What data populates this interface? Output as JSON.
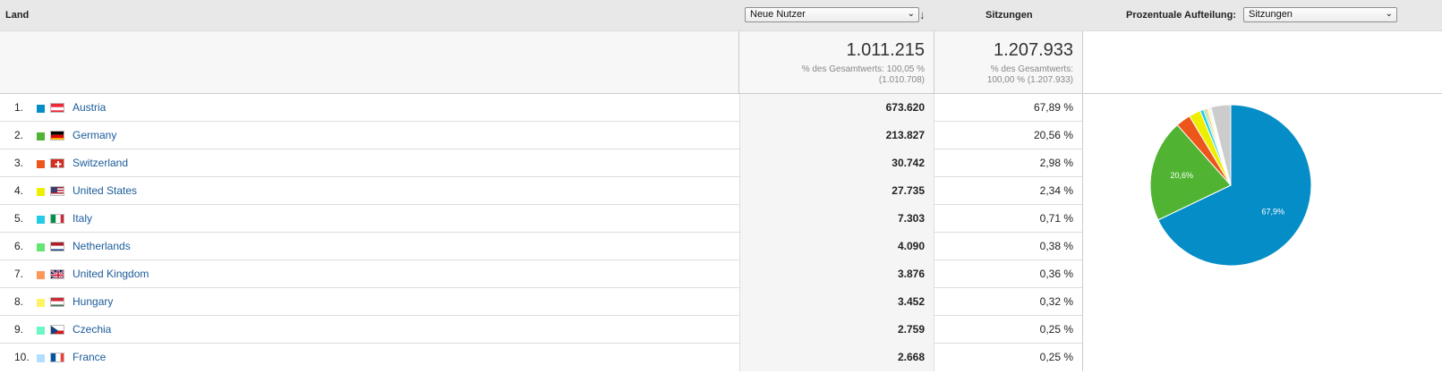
{
  "header": {
    "country_col": "Land",
    "metric_select": "Neue Nutzer",
    "sessions_col": "Sitzungen",
    "distribution_label": "Prozentuale Aufteilung:",
    "distribution_select": "Sitzungen"
  },
  "totals": {
    "new_users": "1.011.215",
    "new_users_sub1": "% des Gesamtwerts: 100,05 %",
    "new_users_sub2": "(1.010.708)",
    "sessions": "1.207.933",
    "sessions_sub1": "% des Gesamtwerts:",
    "sessions_sub2": "100,00 % (1.207.933)"
  },
  "rows": [
    {
      "rank": "1.",
      "country": "Austria",
      "color": "#058dc7",
      "flag": "at",
      "new_users": "673.620",
      "share": "67,89 %",
      "pct": 67.89
    },
    {
      "rank": "2.",
      "country": "Germany",
      "color": "#50b432",
      "flag": "de",
      "new_users": "213.827",
      "share": "20,56 %",
      "pct": 20.56
    },
    {
      "rank": "3.",
      "country": "Switzerland",
      "color": "#ed561b",
      "flag": "ch",
      "new_users": "30.742",
      "share": "2,98 %",
      "pct": 2.98
    },
    {
      "rank": "4.",
      "country": "United States",
      "color": "#edef00",
      "flag": "us",
      "new_users": "27.735",
      "share": "2,34 %",
      "pct": 2.34
    },
    {
      "rank": "5.",
      "country": "Italy",
      "color": "#24cbe5",
      "flag": "it",
      "new_users": "7.303",
      "share": "0,71 %",
      "pct": 0.71
    },
    {
      "rank": "6.",
      "country": "Netherlands",
      "color": "#64e572",
      "flag": "nl",
      "new_users": "4.090",
      "share": "0,38 %",
      "pct": 0.38
    },
    {
      "rank": "7.",
      "country": "United Kingdom",
      "color": "#ff9655",
      "flag": "gb",
      "new_users": "3.876",
      "share": "0,36 %",
      "pct": 0.36
    },
    {
      "rank": "8.",
      "country": "Hungary",
      "color": "#fff263",
      "flag": "hu",
      "new_users": "3.452",
      "share": "0,32 %",
      "pct": 0.32
    },
    {
      "rank": "9.",
      "country": "Czechia",
      "color": "#6af9c4",
      "flag": "cz",
      "new_users": "2.759",
      "share": "0,25 %",
      "pct": 0.25
    },
    {
      "rank": "10.",
      "country": "France",
      "color": "#b2deff",
      "flag": "fr",
      "new_users": "2.668",
      "share": "0,25 %",
      "pct": 0.25
    }
  ],
  "chart_data": {
    "type": "pie",
    "slices": [
      {
        "label": "Austria",
        "value": 67.89,
        "color": "#058dc7",
        "text": "67,9%"
      },
      {
        "label": "Germany",
        "value": 20.56,
        "color": "#50b432",
        "text": "20,6%"
      },
      {
        "label": "Switzerland",
        "value": 2.98,
        "color": "#ed561b"
      },
      {
        "label": "United States",
        "value": 2.34,
        "color": "#edef00"
      },
      {
        "label": "Italy",
        "value": 0.71,
        "color": "#24cbe5"
      },
      {
        "label": "Netherlands",
        "value": 0.38,
        "color": "#64e572"
      },
      {
        "label": "United Kingdom",
        "value": 0.36,
        "color": "#ff9655"
      },
      {
        "label": "Hungary",
        "value": 0.32,
        "color": "#fff263"
      },
      {
        "label": "Czechia",
        "value": 0.25,
        "color": "#6af9c4"
      },
      {
        "label": "France",
        "value": 0.25,
        "color": "#b2deff"
      },
      {
        "label": "Other",
        "value": 3.96,
        "color": "#cccccc"
      }
    ]
  }
}
